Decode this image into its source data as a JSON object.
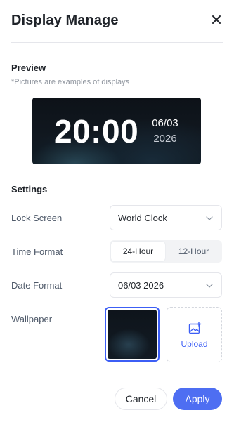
{
  "dialog": {
    "title": "Display Manage",
    "close_icon": "close-icon"
  },
  "preview": {
    "section_title": "Preview",
    "hint": "*Pictures are examples of displays",
    "time": "20:00",
    "date": "06/03",
    "year": "2026"
  },
  "settings": {
    "section_title": "Settings",
    "lock_screen": {
      "label": "Lock Screen",
      "value": "World Clock",
      "icon": "chevron-down-icon"
    },
    "time_format": {
      "label": "Time Format",
      "options": [
        "24-Hour",
        "12-Hour"
      ],
      "selected": "24-Hour"
    },
    "date_format": {
      "label": "Date Format",
      "value": "06/03 2026",
      "icon": "chevron-down-icon"
    },
    "wallpaper": {
      "label": "Wallpaper",
      "upload_label": "Upload",
      "upload_icon": "image-add-icon"
    }
  },
  "footer": {
    "cancel_label": "Cancel",
    "apply_label": "Apply"
  },
  "colors": {
    "accent": "#4e6ef2",
    "selected_border": "#3c5ef5",
    "text_primary": "#1f2329",
    "text_secondary": "#4e5969",
    "text_hint": "#8f959e"
  }
}
